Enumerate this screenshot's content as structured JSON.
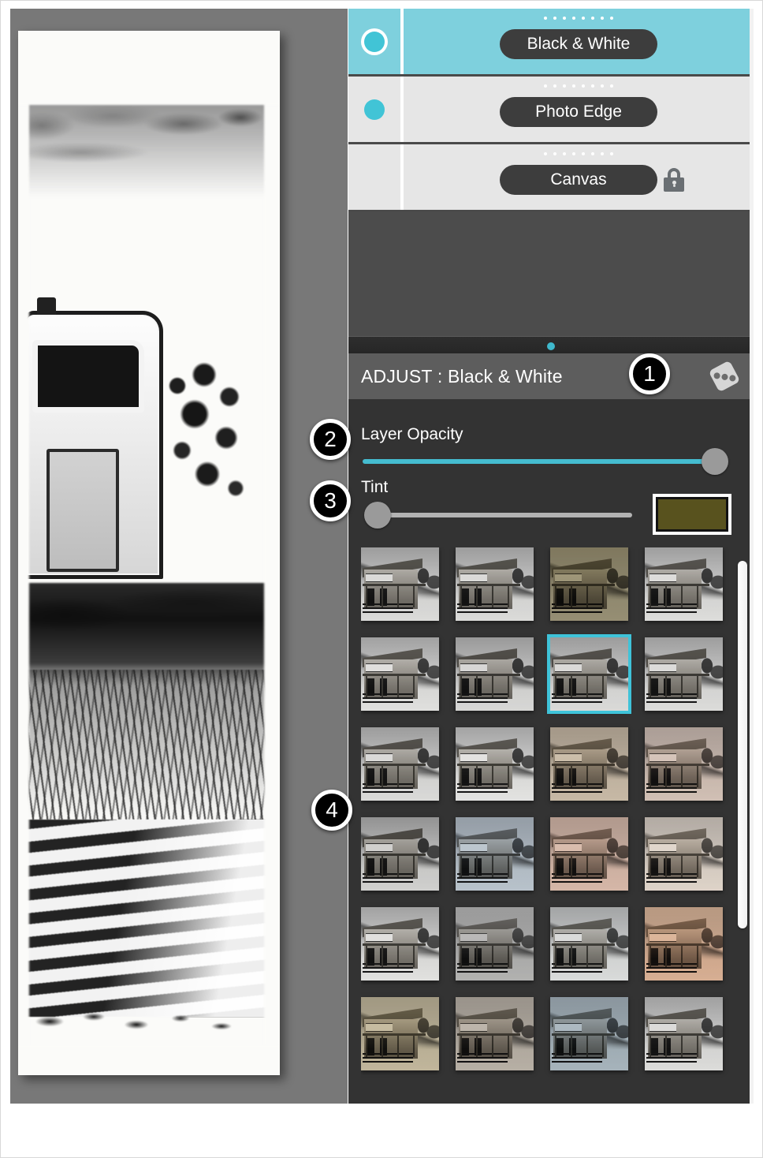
{
  "layers": {
    "rows": [
      {
        "name": "Black & White",
        "visible": true,
        "selected": true,
        "locked": false,
        "vis_style": "ring"
      },
      {
        "name": "Photo Edge",
        "visible": true,
        "selected": false,
        "locked": false,
        "vis_style": "solid"
      },
      {
        "name": "Canvas",
        "visible": false,
        "selected": false,
        "locked": true,
        "vis_style": "none"
      }
    ],
    "drag_handle_dots": 8
  },
  "adjust": {
    "title": "ADJUST : Black & White",
    "randomize_icon": "dice-icon",
    "opacity": {
      "label": "Layer Opacity",
      "value": 100,
      "min": 0,
      "max": 100
    },
    "tint": {
      "label": "Tint",
      "value": 0,
      "min": 0,
      "max": 100,
      "swatch_color": "#58521e"
    }
  },
  "presets": {
    "selected_index": 6,
    "scroll_percent": 3,
    "items": [
      {
        "index": 0,
        "tone": "neutral-gray",
        "tint_hex": "#9e9e9e",
        "strength": 0.0
      },
      {
        "index": 1,
        "tone": "neutral-gray",
        "tint_hex": "#9e9e9e",
        "strength": 0.0
      },
      {
        "index": 2,
        "tone": "olive-sepia",
        "tint_hex": "#6d6038",
        "strength": 0.55
      },
      {
        "index": 3,
        "tone": "neutral-contrast",
        "tint_hex": "#a8a8a8",
        "strength": 0.0
      },
      {
        "index": 4,
        "tone": "soft-gray",
        "tint_hex": "#b4b4b4",
        "strength": 0.0
      },
      {
        "index": 5,
        "tone": "high-contrast-gray",
        "tint_hex": "#8f8f8f",
        "strength": 0.0
      },
      {
        "index": 6,
        "tone": "neutral-gray-selected",
        "tint_hex": "#9a9a9a",
        "strength": 0.0
      },
      {
        "index": 7,
        "tone": "flat-gray",
        "tint_hex": "#a2a2a2",
        "strength": 0.0
      },
      {
        "index": 8,
        "tone": "cool-gray",
        "tint_hex": "#9c9c9c",
        "strength": 0.0
      },
      {
        "index": 9,
        "tone": "bright-gray",
        "tint_hex": "#c0c0c0",
        "strength": 0.0
      },
      {
        "index": 10,
        "tone": "warm-sepia",
        "tint_hex": "#b39878",
        "strength": 0.45
      },
      {
        "index": 11,
        "tone": "pink-sepia",
        "tint_hex": "#c3a494",
        "strength": 0.45
      },
      {
        "index": 12,
        "tone": "dark-charcoal",
        "tint_hex": "#6f6f6f",
        "strength": 0.0
      },
      {
        "index": 13,
        "tone": "cool-blue",
        "tint_hex": "#8fa3b8",
        "strength": 0.4
      },
      {
        "index": 14,
        "tone": "salmon",
        "tint_hex": "#cf9c84",
        "strength": 0.5
      },
      {
        "index": 15,
        "tone": "pale-peach",
        "tint_hex": "#d8c5b2",
        "strength": 0.4
      },
      {
        "index": 16,
        "tone": "light-gray",
        "tint_hex": "#b8b8b8",
        "strength": 0.0
      },
      {
        "index": 17,
        "tone": "coral",
        "tint_hex": "#e2a храм88",
        "strength": 0.6
      },
      {
        "index": 18,
        "tone": "cool-silver",
        "tint_hex": "#b6bcbe",
        "strength": 0.15
      },
      {
        "index": 19,
        "tone": "orange-copper",
        "tint_hex": "#d79a72",
        "strength": 0.6
      },
      {
        "index": 20,
        "tone": "khaki-gold",
        "tint_hex": "#ab9a6e",
        "strength": 0.5
      },
      {
        "index": 21,
        "tone": "violet-gold",
        "tint_hex": "#9c8f7e",
        "strength": 0.5
      },
      {
        "index": 22,
        "tone": "steel-blue",
        "tint_hex": "#7f95a5",
        "strength": 0.5
      },
      {
        "index": 23,
        "tone": "neutral-silver",
        "tint_hex": "#aeaeae",
        "strength": 0.05
      }
    ]
  },
  "callouts": [
    {
      "number": "1",
      "target": "adjust-panel-header"
    },
    {
      "number": "2",
      "target": "layer-opacity-slider"
    },
    {
      "number": "3",
      "target": "tint-slider"
    },
    {
      "number": "4",
      "target": "preset-thumbnail-grid"
    }
  ],
  "colors": {
    "accent_cyan": "#41c4d6",
    "selected_layer_bg": "#7ed0dd",
    "layer_bg": "#e6e6e6",
    "panel_bg": "#333333",
    "panel_header_bg": "#5d5d5d",
    "canvas_bg": "#787878",
    "pill_bg": "#3d3d3d",
    "tint_swatch": "#58521e"
  }
}
